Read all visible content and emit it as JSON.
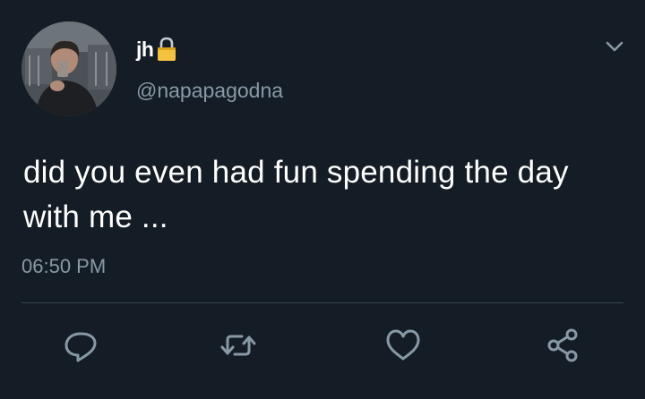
{
  "tweet": {
    "display_name": "jh",
    "handle": "@napapagodna",
    "text": "did you even had fun spending the day with me ...",
    "time": "06:50 PM"
  },
  "icons": {
    "account_badge": "lock-icon",
    "menu": "chevron-down-icon",
    "actions": [
      "reply-icon",
      "retweet-icon",
      "like-icon",
      "share-icon"
    ]
  },
  "colors": {
    "background": "#141d26",
    "primary_text": "#ffffff",
    "secondary_text": "#8899a6",
    "divider": "#38444d",
    "lock": "#f3c240"
  }
}
